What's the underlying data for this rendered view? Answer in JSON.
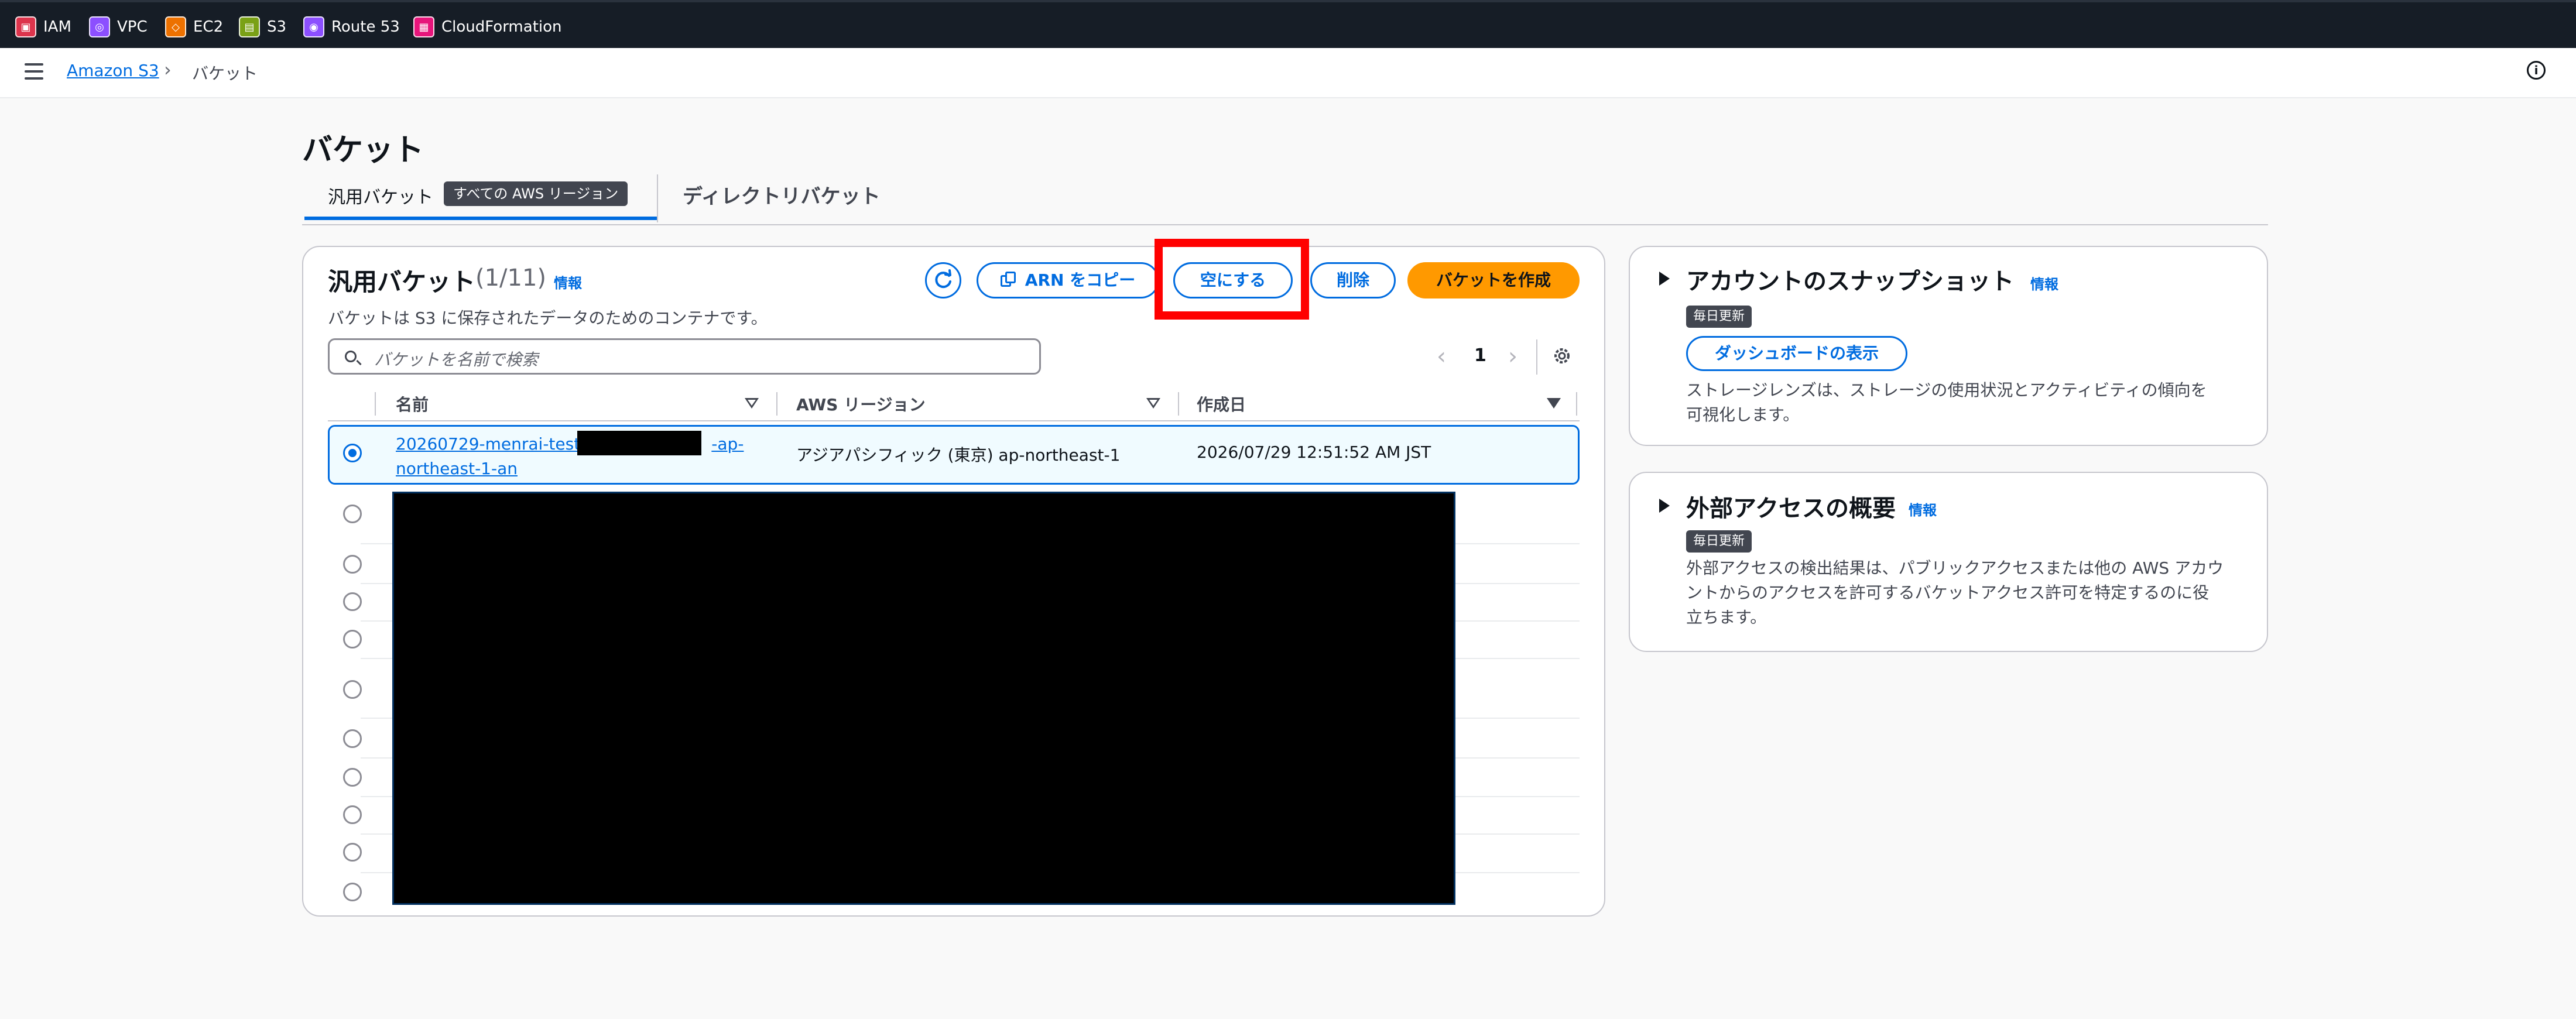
{
  "top_services": [
    {
      "label": "IAM",
      "icon": "iam-icon",
      "color": "#dd344c"
    },
    {
      "label": "VPC",
      "icon": "vpc-icon",
      "color": "#8c4fff"
    },
    {
      "label": "EC2",
      "icon": "ec2-icon",
      "color": "#ed7100"
    },
    {
      "label": "S3",
      "icon": "s3-icon",
      "color": "#7aa116"
    },
    {
      "label": "Route 53",
      "icon": "route53-icon",
      "color": "#8c4fff"
    },
    {
      "label": "CloudFormation",
      "icon": "cloudformation-icon",
      "color": "#e7157b"
    }
  ],
  "breadcrumb": {
    "home": "Amazon S3",
    "separator": "›",
    "current": "バケット"
  },
  "page": {
    "title": "バケット"
  },
  "tabs": {
    "general": "汎用バケット",
    "general_badge": "すべての AWS リージョン",
    "directory": "ディレクトリバケット"
  },
  "bucket_panel": {
    "title": "汎用バケット",
    "count": "(1/11)",
    "info": "情報",
    "description": "バケットは S3 に保存されたデータのためのコンテナです。",
    "buttons": {
      "copy_arn": "ARN をコピー",
      "empty": "空にする",
      "delete": "削除",
      "create": "バケットを作成"
    },
    "search_placeholder": "バケットを名前で検索",
    "page_number": "1",
    "columns": {
      "name": "名前",
      "region": "AWS リージョン",
      "created": "作成日"
    },
    "selected_row": {
      "name_line1": "20260729-menrai-test-",
      "name_line1_suffix": "-ap-",
      "name_line2": "northeast-1-an",
      "region": "アジアパシフィック (東京) ap-northeast-1",
      "created": "2026/07/29 12:51:52 AM JST"
    }
  },
  "snapshot_panel": {
    "title": "アカウントのスナップショット",
    "info": "情報",
    "badge": "毎日更新",
    "button": "ダッシュボードの表示",
    "description_line1": "ストレージレンズは、ストレージの使用状況とアクティビティの傾向を",
    "description_line2": "可視化します。"
  },
  "external_panel": {
    "title": "外部アクセスの概要",
    "info": "情報",
    "badge": "毎日更新",
    "description_line1": "外部アクセスの検出結果は、パブリックアクセスまたは他の AWS アカウ",
    "description_line2": "ントからのアクセスを許可するバケットアクセス許可を特定するのに役",
    "description_line3": "立ちます。"
  },
  "colors": {
    "accent": "#006ce0",
    "primary_button": "#ff9900",
    "highlight": "#ff0000",
    "topbar": "#161d26"
  }
}
